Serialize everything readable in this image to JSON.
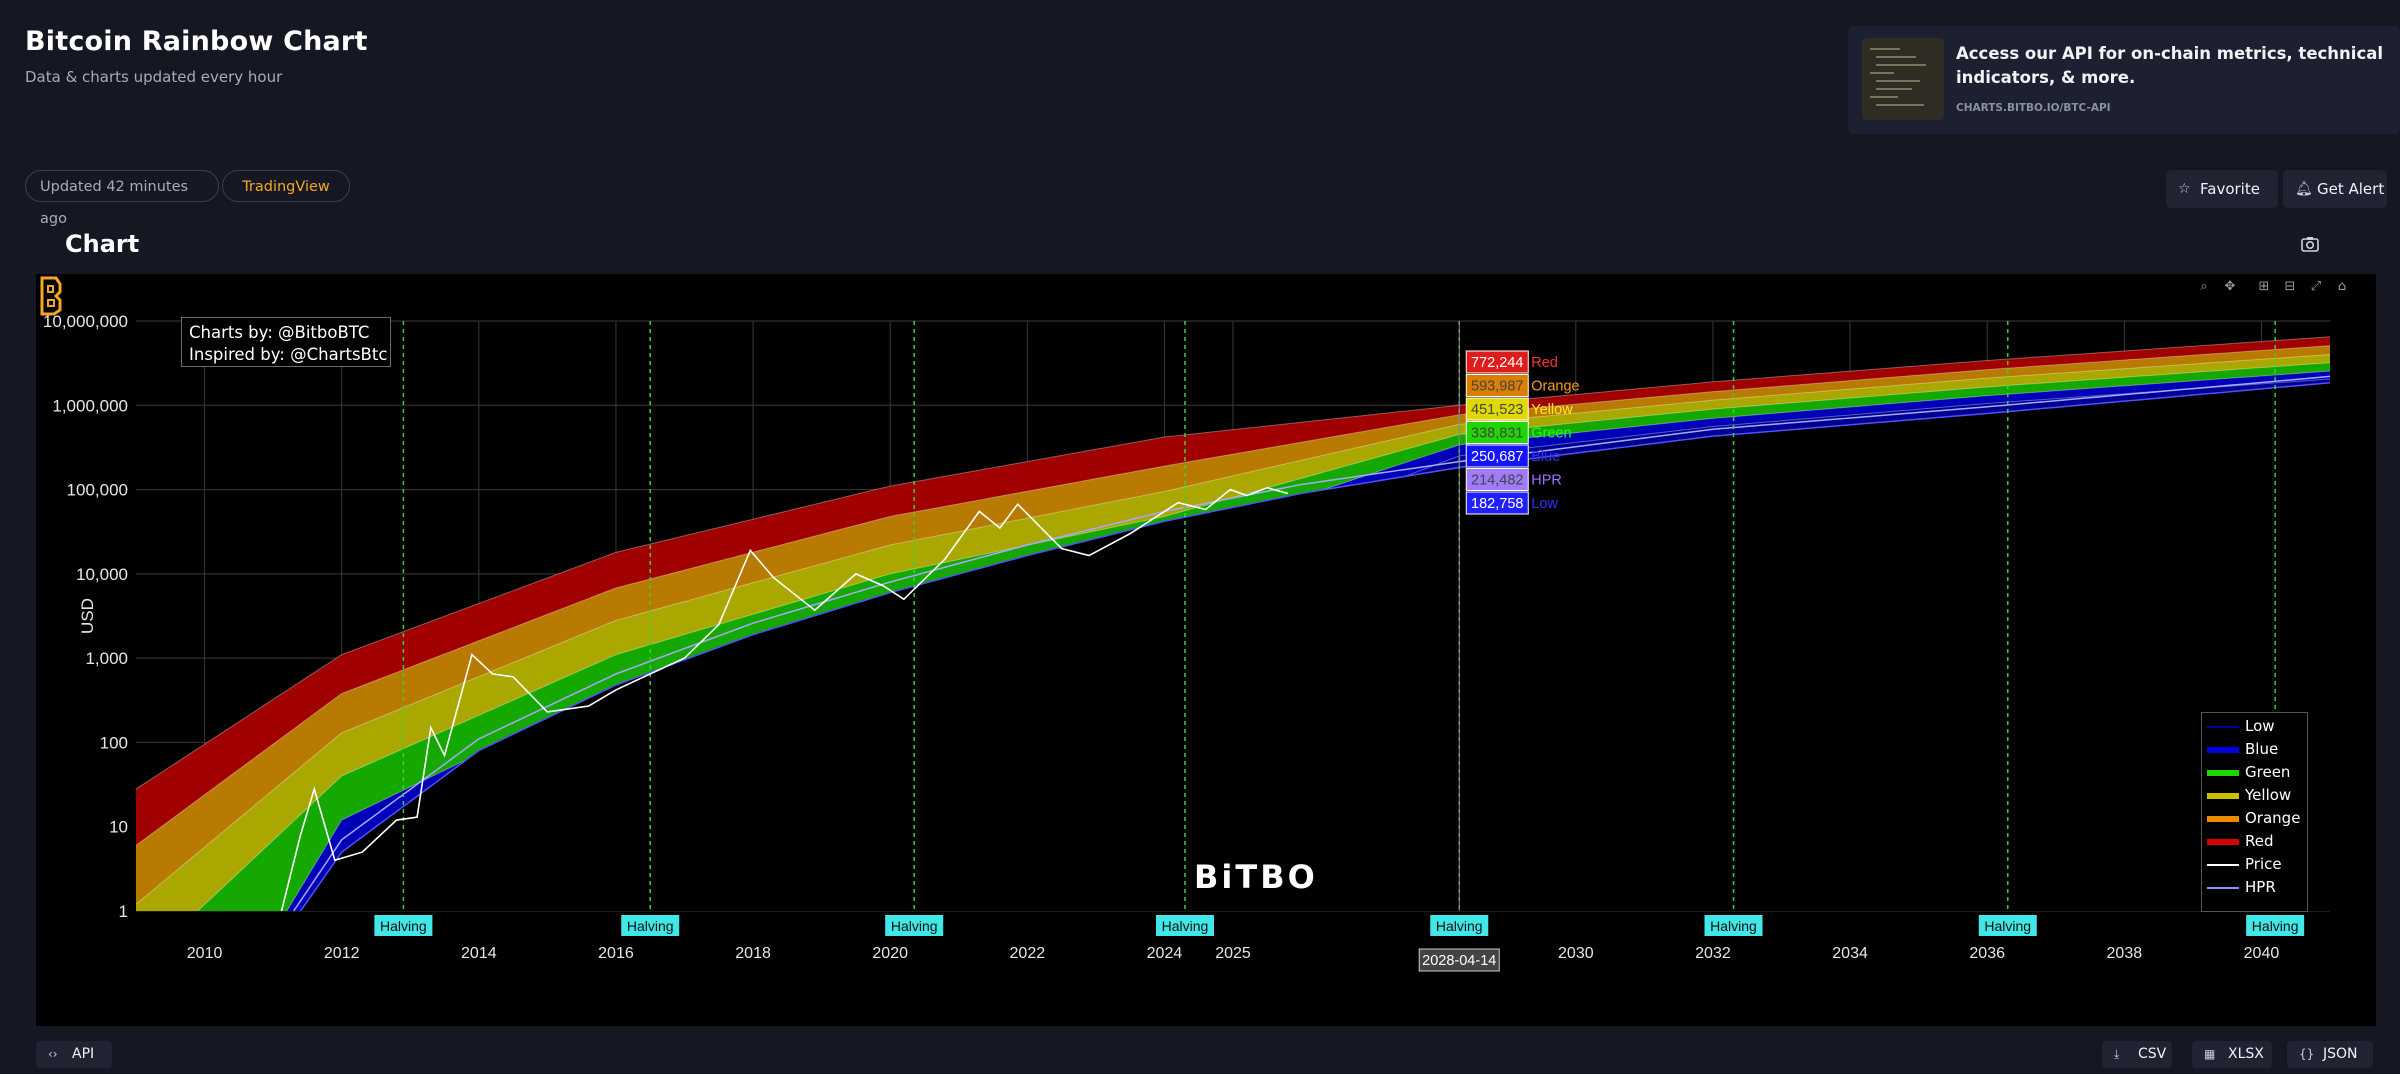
{
  "header": {
    "title": "Bitcoin Rainbow Chart",
    "subtitle": "Data & charts updated every hour"
  },
  "promo": {
    "text": "Access our API for on-chain metrics, technical indicators, & more.",
    "url": "CHARTS.BITBO.IO/BTC-API"
  },
  "pills": {
    "updated": "Updated 42 minutes ago",
    "tradingview": "TradingView"
  },
  "actions": {
    "favorite": "Favorite",
    "alert": "Get Alert"
  },
  "chart_section": {
    "title": "Chart"
  },
  "colors": {
    "background": "#151823",
    "accent": "#f5a623",
    "halving": "#41e6e6",
    "red": "#d90000",
    "orange": "#ea8a00",
    "yellow": "#f5f000",
    "green": "#1fd600",
    "blue": "#0000e0",
    "low": "#5050ff",
    "hpr": "#9f7bff"
  },
  "icons": {
    "favorite": "star-icon",
    "alert": "bell-icon",
    "camera": "camera-icon",
    "api": "code-icon",
    "csv": "download-icon",
    "xlsx": "table-icon",
    "json": "braces-icon"
  },
  "chart_data": {
    "type": "area",
    "title": "",
    "xlabel": "",
    "ylabel": "USD",
    "y_scale": "log",
    "xlim": [
      2009,
      2041
    ],
    "ylim": [
      1,
      10000000
    ],
    "x_ticks": [
      "2010",
      "2012",
      "2014",
      "2016",
      "2018",
      "2020",
      "2022",
      "2024",
      "2025",
      "2030",
      "2032",
      "2034",
      "2036",
      "2038",
      "2040"
    ],
    "y_ticks": [
      "1",
      "10",
      "100",
      "1,000",
      "10,000",
      "100,000",
      "1,000,000",
      "10,000,000"
    ],
    "credits": [
      "Charts by: @BitboBTC",
      "Inspired by: @ChartsBtc"
    ],
    "halvings": [
      {
        "label": "Halving",
        "date": 2012.9
      },
      {
        "label": "Halving",
        "date": 2016.5
      },
      {
        "label": "Halving",
        "date": 2020.35
      },
      {
        "label": "Halving",
        "date": 2024.3
      },
      {
        "label": "Halving",
        "date": 2028.3
      },
      {
        "label": "Halving",
        "date": 2032.3
      },
      {
        "label": "Halving",
        "date": 2036.3
      },
      {
        "label": "Halving",
        "date": 2040.2
      }
    ],
    "hover": {
      "date": "2028-04-14",
      "values": [
        {
          "name": "Red",
          "value": "772,244"
        },
        {
          "name": "Orange",
          "value": "593,987"
        },
        {
          "name": "Yellow",
          "value": "451,523"
        },
        {
          "name": "Green",
          "value": "338,831"
        },
        {
          "name": "Blue",
          "value": "250,687"
        },
        {
          "name": "HPR",
          "value": "214,482"
        },
        {
          "name": "Low",
          "value": "182,758"
        }
      ]
    },
    "legend_position": "bottom-right",
    "legend": [
      "Low",
      "Blue",
      "Green",
      "Yellow",
      "Orange",
      "Red",
      "Price",
      "HPR"
    ],
    "bands": [
      {
        "name": "Red",
        "upper": {
          "x": [
            2009,
            2012,
            2016,
            2020,
            2024,
            2028.3,
            2032,
            2036,
            2041
          ],
          "y": [
            28,
            1100,
            18000,
            110000,
            420000,
            1000000,
            1900000,
            3400000,
            6500000
          ]
        }
      },
      {
        "name": "Orange",
        "upper": {
          "x": [
            2009,
            2012,
            2016,
            2020,
            2024,
            2028.3,
            2032,
            2036,
            2041
          ],
          "y": [
            6,
            380,
            6800,
            48000,
            190000,
            772244,
            1450000,
            2650000,
            5100000
          ]
        }
      },
      {
        "name": "Yellow",
        "upper": {
          "x": [
            2009,
            2012,
            2016,
            2020,
            2024,
            2028.3,
            2032,
            2036,
            2041
          ],
          "y": [
            1.2,
            130,
            2800,
            22000,
            95000,
            593987,
            1150000,
            2100000,
            4000000
          ]
        }
      },
      {
        "name": "Green",
        "upper": {
          "x": [
            2009.9,
            2012,
            2016,
            2020,
            2024,
            2028.3,
            2032,
            2036,
            2041
          ],
          "y": [
            1,
            40,
            1100,
            10000,
            48000,
            451523,
            900000,
            1650000,
            3200000
          ]
        }
      },
      {
        "name": "Blue",
        "upper": {
          "x": [
            2011.2,
            2012,
            2016,
            2020,
            2024,
            2028.3,
            2032,
            2036,
            2041
          ],
          "y": [
            1,
            12,
            450,
            4800,
            24000,
            338831,
            700000,
            1300000,
            2550000
          ]
        }
      },
      {
        "name": "Low",
        "upper": {
          "x": [
            2011.7,
            2012,
            2016,
            2020,
            2024,
            2028.3,
            2032,
            2036,
            2041
          ],
          "y": [
            1,
            4,
            170,
            2100,
            12000,
            250687,
            560000,
            1050000,
            2050000
          ]
        }
      }
    ],
    "hpr": {
      "x": [
        2011.3,
        2012,
        2014,
        2016,
        2018,
        2020,
        2022,
        2024,
        2026,
        2028.3,
        2032,
        2036,
        2041
      ],
      "y": [
        1,
        7,
        110,
        650,
        2600,
        8000,
        22000,
        55000,
        115000,
        214482,
        520000,
        960000,
        2200000
      ]
    },
    "low": {
      "x": [
        2011.4,
        2012,
        2014,
        2016,
        2018,
        2020,
        2022,
        2024,
        2026,
        2028.3,
        2032,
        2036,
        2041
      ],
      "y": [
        1,
        5,
        80,
        480,
        1900,
        6000,
        16500,
        42000,
        90000,
        182758,
        430000,
        800000,
        1850000
      ]
    },
    "price": {
      "x": [
        2010.5,
        2011.0,
        2011.4,
        2011.6,
        2011.9,
        2012.3,
        2012.8,
        2013.1,
        2013.3,
        2013.5,
        2013.9,
        2014.2,
        2014.5,
        2015.0,
        2015.6,
        2016.0,
        2016.5,
        2017.0,
        2017.5,
        2017.96,
        2018.3,
        2018.9,
        2019.5,
        2019.9,
        2020.2,
        2020.8,
        2021.3,
        2021.6,
        2021.86,
        2022.5,
        2022.9,
        2023.5,
        2024.2,
        2024.6,
        2024.96,
        2025.2,
        2025.5,
        2025.8
      ],
      "y": [
        0.8,
        0.4,
        8,
        28,
        4,
        5,
        12,
        13,
        150,
        70,
        1100,
        650,
        600,
        230,
        270,
        420,
        650,
        1000,
        2500,
        19000,
        9000,
        3700,
        10000,
        7200,
        5000,
        15000,
        55000,
        35000,
        67000,
        20000,
        16500,
        30000,
        70000,
        58000,
        100000,
        85000,
        105000,
        90000
      ]
    }
  },
  "bottom": {
    "api": "API",
    "csv": "CSV",
    "xlsx": "XLSX",
    "json": "JSON"
  }
}
